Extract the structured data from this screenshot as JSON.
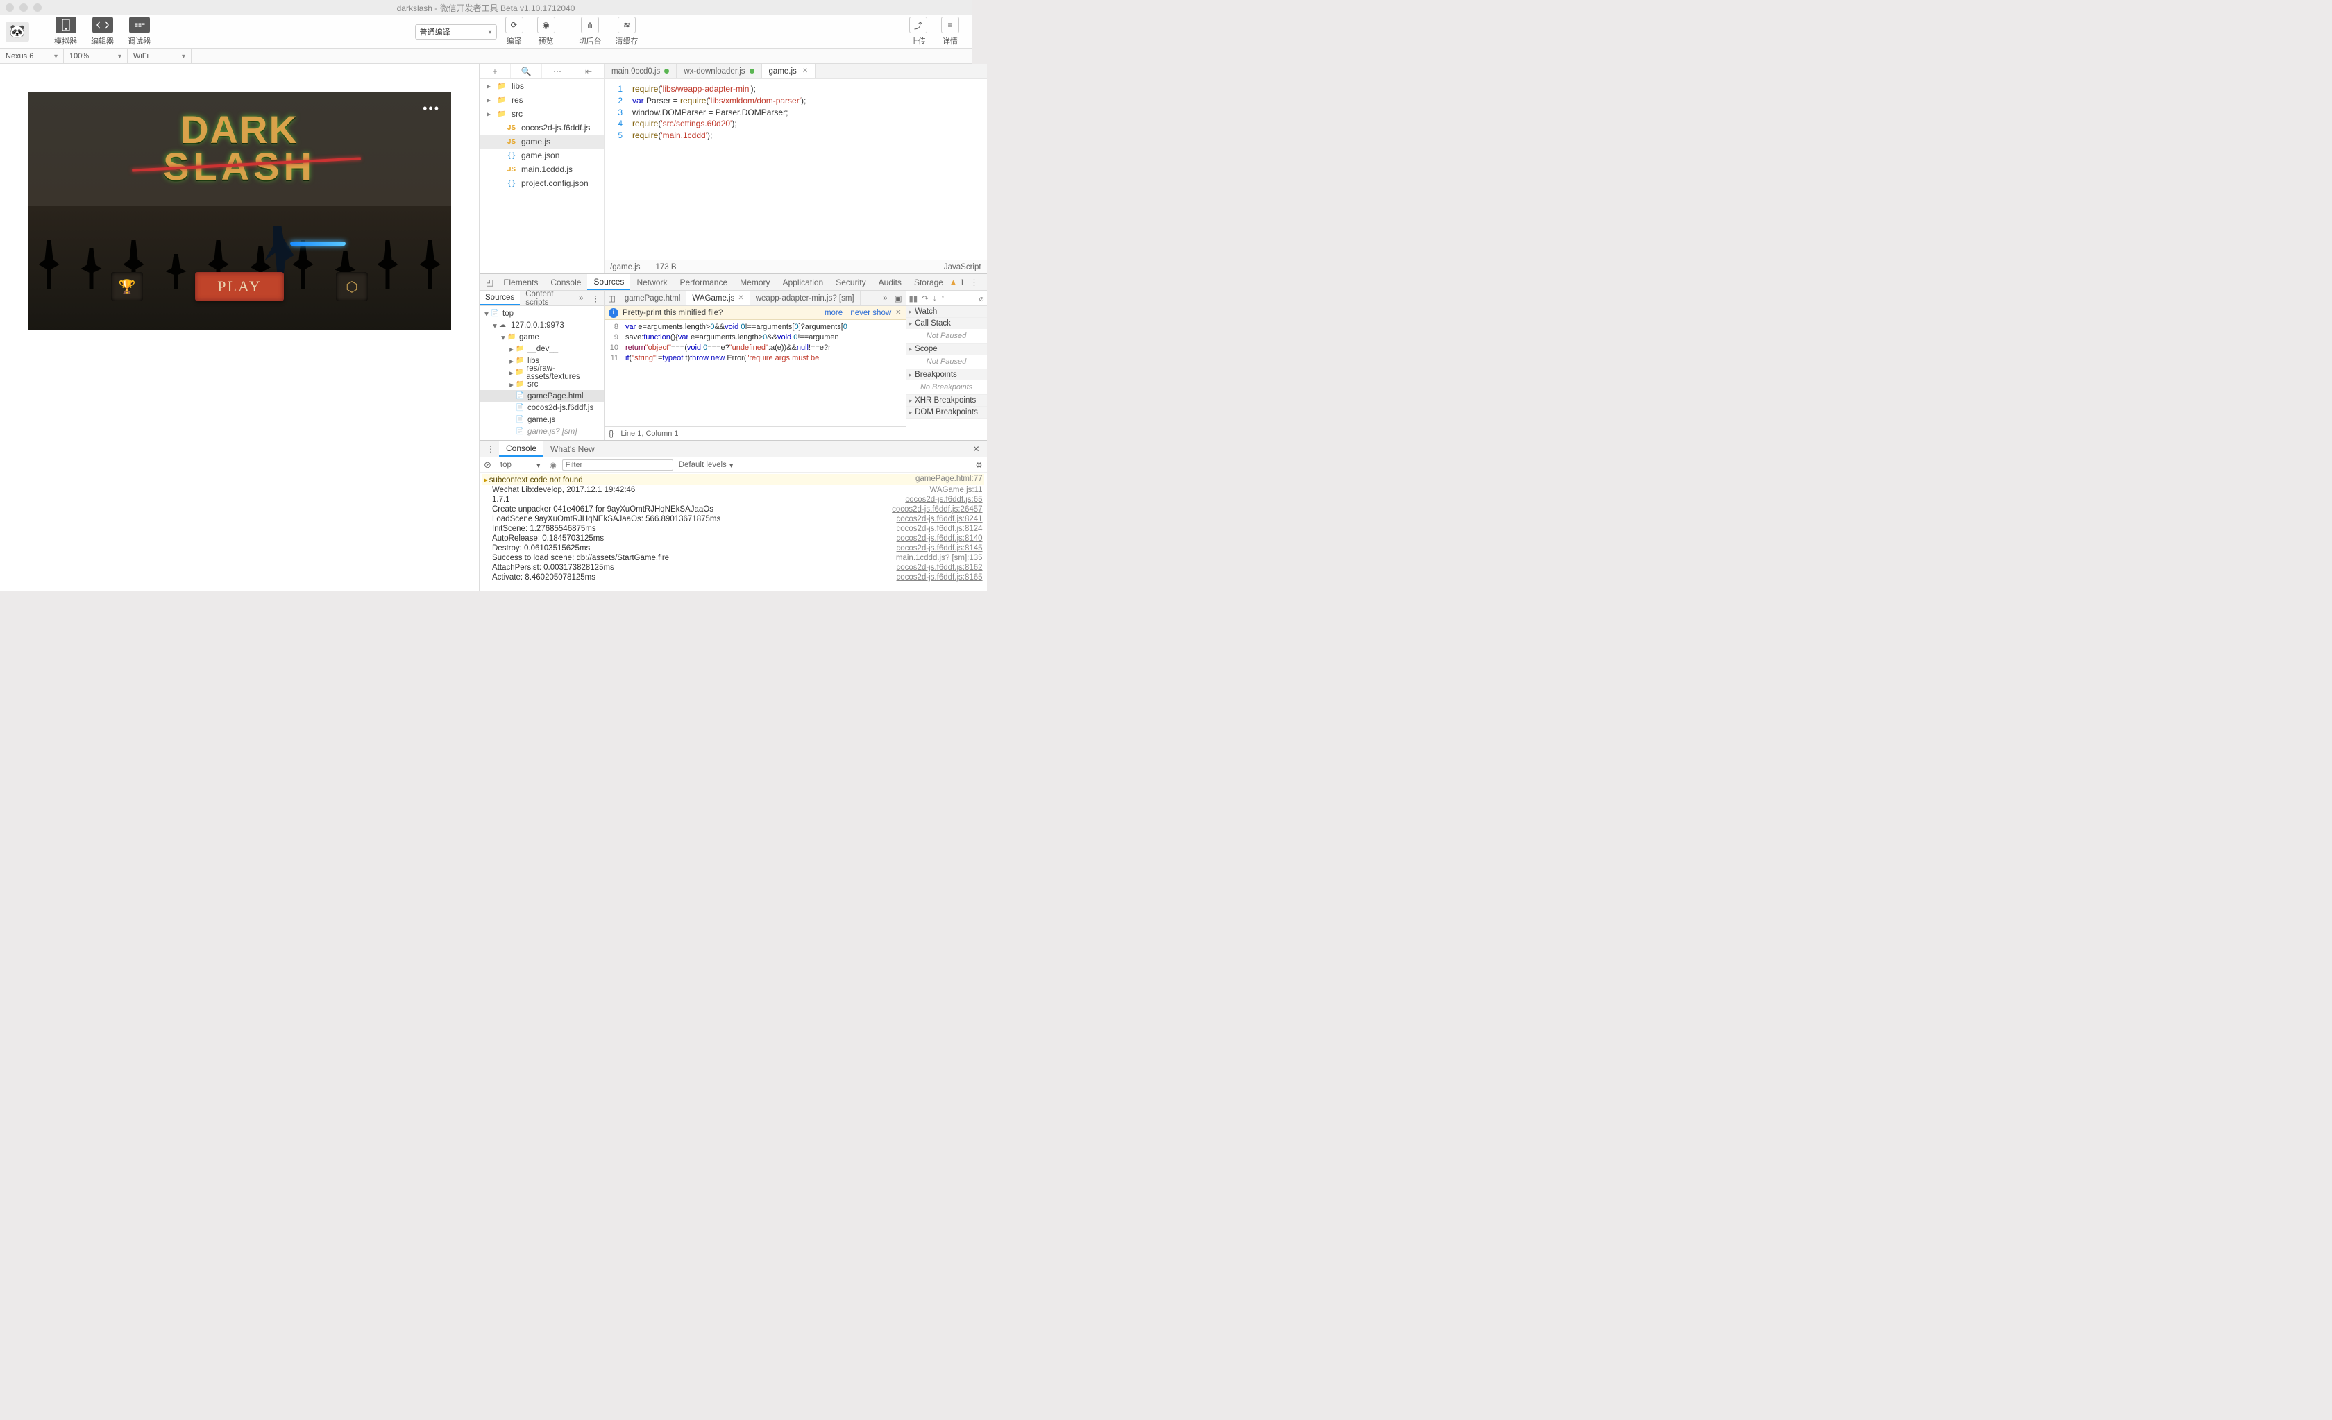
{
  "window": {
    "title": "darkslash - 微信开发者工具 Beta v1.10.1712040"
  },
  "toolbar": {
    "simulator": "模拟器",
    "editor": "编辑器",
    "debugger": "调试器",
    "compile_mode": "普通编译",
    "compile": "编译",
    "preview": "预览",
    "background": "切后台",
    "clear_cache": "清缓存",
    "upload": "上传",
    "detail": "详情"
  },
  "device": {
    "name": "Nexus 6",
    "zoom": "100%",
    "network": "WiFi"
  },
  "files": {
    "folders": [
      "libs",
      "res",
      "src"
    ],
    "items": [
      {
        "type": "js",
        "name": "cocos2d-js.f6ddf.js"
      },
      {
        "type": "js",
        "name": "game.js",
        "selected": true
      },
      {
        "type": "json",
        "name": "game.json"
      },
      {
        "type": "js",
        "name": "main.1cddd.js"
      },
      {
        "type": "json",
        "name": "project.config.json"
      }
    ]
  },
  "editor_tabs": [
    {
      "label": "main.0ccd0.js",
      "modified": true
    },
    {
      "label": "wx-downloader.js",
      "modified": true
    },
    {
      "label": "game.js",
      "active": true
    }
  ],
  "code": [
    {
      "n": "1",
      "h": "<span class='kfn'>require</span>(<span class='kstr'>'libs/weapp-adapter-min'</span>);"
    },
    {
      "n": "2",
      "h": "<span class='k0'>var</span> Parser = <span class='kfn'>require</span>(<span class='kstr'>'libs/xmldom/dom-parser'</span>);"
    },
    {
      "n": "3",
      "h": "window.DOMParser = Parser.DOMParser;"
    },
    {
      "n": "4",
      "h": "<span class='kfn'>require</span>(<span class='kstr'>'src/settings.60d20'</span>);"
    },
    {
      "n": "5",
      "h": "<span class='kfn'>require</span>(<span class='kstr'>'main.1cddd'</span>);"
    }
  ],
  "status": {
    "path": "/game.js",
    "size": "173 B",
    "lang": "JavaScript"
  },
  "game": {
    "title1": "DARK",
    "title2": "SLASH",
    "play": "PLAY"
  },
  "devtools": {
    "tabs": [
      "Elements",
      "Console",
      "Sources",
      "Network",
      "Performance",
      "Memory",
      "Application",
      "Security",
      "Audits",
      "Storage"
    ],
    "active": "Sources",
    "warn_count": "1",
    "left_tabs": {
      "a": "Sources",
      "b": "Content scripts"
    },
    "tree": [
      {
        "lvl": 0,
        "arrow": "▾",
        "ic": "doc",
        "label": "top"
      },
      {
        "lvl": 1,
        "arrow": "▾",
        "ic": "cloud",
        "label": "127.0.0.1:9973"
      },
      {
        "lvl": 2,
        "arrow": "▾",
        "ic": "folder",
        "label": "game"
      },
      {
        "lvl": 3,
        "arrow": "▸",
        "ic": "folder",
        "label": "__dev__"
      },
      {
        "lvl": 3,
        "arrow": "▸",
        "ic": "folder",
        "label": "libs"
      },
      {
        "lvl": 3,
        "arrow": "▸",
        "ic": "folder",
        "label": "res/raw-assets/textures"
      },
      {
        "lvl": 3,
        "arrow": "▸",
        "ic": "folder",
        "label": "src"
      },
      {
        "lvl": 3,
        "arrow": "",
        "ic": "doc",
        "label": "gamePage.html",
        "sel": true
      },
      {
        "lvl": 3,
        "arrow": "",
        "ic": "js",
        "label": "cocos2d-js.f6ddf.js"
      },
      {
        "lvl": 3,
        "arrow": "",
        "ic": "js",
        "label": "game.js"
      },
      {
        "lvl": 3,
        "arrow": "",
        "ic": "js",
        "label": "game.js? [sm]",
        "dim": true
      }
    ],
    "file_tabs": [
      {
        "label": "gamePage.html"
      },
      {
        "label": "WAGame.js",
        "active": true
      },
      {
        "label": "weapp-adapter-min.js? [sm]"
      }
    ],
    "pretty": {
      "msg": "Pretty-print this minified file?",
      "more": "more",
      "never": "never show"
    },
    "minicode": [
      {
        "n": "8",
        "h": "<span class='v'>var</span> e=arguments.length&gt;<span class='num'>0</span>&amp;&amp;<span class='v'>void</span> <span class='num'>0</span>!==arguments[<span class='num'>0</span>]?arguments[<span class='num'>0</span>"
      },
      {
        "n": "9",
        "h": "save:<span class='v'>function</span>(){<span class='v'>var</span> e=arguments.length&gt;<span class='num'>0</span>&amp;&amp;<span class='v'>void</span> <span class='num'>0</span>!==argumen"
      },
      {
        "n": "10",
        "h": "<span class='f'>return</span><span class='s'>\"object\"</span>===(<span class='v'>void</span> <span class='num'>0</span>===e?<span class='s'>\"undefined\"</span>:a(e))&amp;&amp;<span class='v'>null</span>!==e?r"
      },
      {
        "n": "11",
        "h": "<span class='v'>if</span>(<span class='s'>\"string\"</span>!=<span class='v'>typeof</span> t)<span class='v'>throw new</span> <span class='n'>Error</span>(<span class='s'>\"require args must be</span>"
      }
    ],
    "footer_info": "Line 1, Column 1",
    "right": {
      "sections": [
        {
          "t": "Watch",
          "b": ""
        },
        {
          "t": "Call Stack",
          "b": "Not Paused"
        },
        {
          "t": "Scope",
          "b": "Not Paused"
        },
        {
          "t": "Breakpoints",
          "b": "No Breakpoints"
        },
        {
          "t": "XHR Breakpoints",
          "b": ""
        },
        {
          "t": "DOM Breakpoints",
          "b": ""
        }
      ]
    }
  },
  "drawer": {
    "tabs": {
      "a": "Console",
      "b": "What's New"
    },
    "ctx": "top",
    "filter_placeholder": "Filter",
    "levels": "Default levels",
    "logs": [
      {
        "warn": true,
        "msg": "subcontext code not found",
        "src": "gamePage.html:77"
      },
      {
        "msg": "Wechat Lib:develop, 2017.12.1 19:42:46",
        "src": "WAGame.js:11"
      },
      {
        "msg": "1.7.1",
        "src": "cocos2d-js.f6ddf.js:65"
      },
      {
        "msg": "Create unpacker 041e40617 for 9ayXuOmtRJHqNEkSAJaaOs",
        "src": "cocos2d-js.f6ddf.js:26457"
      },
      {
        "msg": "LoadScene 9ayXuOmtRJHqNEkSAJaaOs: 566.89013671875ms",
        "src": "cocos2d-js.f6ddf.js:8241"
      },
      {
        "msg": "InitScene: 1.27685546875ms",
        "src": "cocos2d-js.f6ddf.js:8124"
      },
      {
        "msg": "AutoRelease: 0.1845703125ms",
        "src": "cocos2d-js.f6ddf.js:8140"
      },
      {
        "msg": "Destroy: 0.06103515625ms",
        "src": "cocos2d-js.f6ddf.js:8145"
      },
      {
        "msg": "Success to load scene: db://assets/StartGame.fire",
        "src": "main.1cddd.js? [sm]:135"
      },
      {
        "msg": "AttachPersist: 0.003173828125ms",
        "src": "cocos2d-js.f6ddf.js:8162"
      },
      {
        "msg": "Activate: 8.460205078125ms",
        "src": "cocos2d-js.f6ddf.js:8165"
      }
    ]
  }
}
